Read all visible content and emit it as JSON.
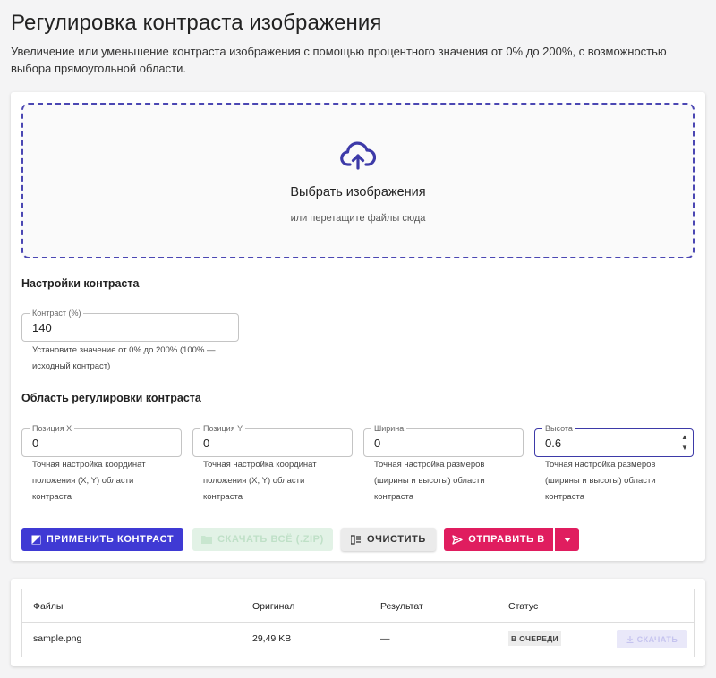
{
  "page": {
    "title": "Регулировка контраста изображения",
    "description": "Увеличение или уменьшение контраста изображения с помощью процентного значения от 0% до 200%, с возможностью выбора прямоугольной области."
  },
  "dropzone": {
    "title": "Выбрать изображения",
    "subtitle": "или перетащите файлы сюда",
    "icon": "cloud-upload-icon"
  },
  "contrast_settings": {
    "heading": "Настройки контраста",
    "field_label": "Контраст (%)",
    "value": "140",
    "helper": "Установите значение от 0% до 200% (100% —",
    "helper2": "исходный контраст)"
  },
  "area": {
    "heading": "Область регулировки контраста",
    "fields": [
      {
        "label": "Позиция X",
        "value": "0",
        "helper": [
          "Точная настройка координат",
          "положения (X, Y) области",
          "контраста"
        ]
      },
      {
        "label": "Позиция Y",
        "value": "0",
        "helper": [
          "Точная настройка координат",
          "положения (X, Y) области",
          "контраста"
        ]
      },
      {
        "label": "Ширина",
        "value": "0",
        "helper": [
          "Точная настройка размеров",
          "(ширины и высоты) области",
          "контраста"
        ]
      },
      {
        "label": "Высота",
        "value": "0.6",
        "helper": [
          "Точная настройка размеров",
          "(ширины и высоты) области",
          "контраста"
        ]
      }
    ]
  },
  "buttons": {
    "apply": "ПРИМЕНИТЬ КОНТРАСТ",
    "download_zip": "СКАЧАТЬ ВСЁ (.ZIP)",
    "clear": "ОЧИСТИТЬ",
    "send": "ОТПРАВИТЬ В"
  },
  "table": {
    "headers": [
      "Файлы",
      "Оригинал",
      "Результат",
      "Статус"
    ],
    "rows": [
      {
        "file": "sample.png",
        "original": "29,49 KB",
        "result": "—",
        "status": "В ОЧЕРЕДИ",
        "action": "СКАЧАТЬ"
      }
    ]
  },
  "colors": {
    "accent": "#3f3ad4",
    "send": "#e01d5f",
    "zip_disabled": "#e2f2e6"
  }
}
